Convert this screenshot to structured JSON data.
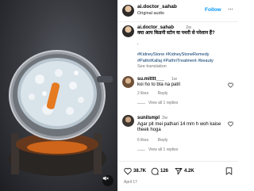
{
  "post": {
    "username": "ai.doctor_sahab",
    "audio": "Original audio",
    "follow_label": "Follow",
    "caption": {
      "username": "ai.doctor_sahab",
      "time": "2w",
      "text": "क्या आप किडनी स्टोन या पथरी से परेशान हैं?",
      "dot": ".",
      "hashtags": "#KidneyStone #KidneyStoneRemedy #PathriKallaj #PathriTreatment #beauty",
      "see_translation": "See translation"
    },
    "comments": [
      {
        "username": "su.mitttt___",
        "time": "1w",
        "text": "koi ho to bta na patri",
        "likes": "2 likes",
        "reply_label": "Reply",
        "view_replies": "View all 1 replies"
      },
      {
        "username": "sunilsmpl",
        "time": "2w",
        "text": "Agar pit mei pathari 14 mm h woh kaise theek hoga",
        "likes": "6 likes",
        "reply_label": "Reply",
        "view_replies": "View all 1 replies"
      }
    ],
    "actions": {
      "like_count": "38.7K",
      "comment_count": "126",
      "share_count": "4.2K"
    },
    "date": "April 17"
  },
  "media": {
    "description_icon": "video-thumbnail",
    "mute_icon": "speaker-muted-icon"
  },
  "colors": {
    "accent": "#0095f6",
    "hashtag": "#00376b",
    "secondary_text": "#737373"
  }
}
